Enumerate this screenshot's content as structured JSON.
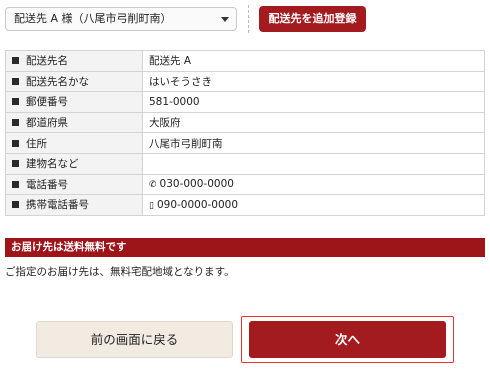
{
  "address_selector": {
    "selected": "配送先 A 様（八尾市弓削町南）"
  },
  "add_address_button": "配送先を追加登録",
  "address_table": [
    {
      "label": "配送先名",
      "value": "配送先 A"
    },
    {
      "label": "配送先名かな",
      "value": "はいそうさき"
    },
    {
      "label": "郵便番号",
      "value": "581-0000"
    },
    {
      "label": "都道府県",
      "value": "大阪府"
    },
    {
      "label": "住所",
      "value": "八尾市弓削町南"
    },
    {
      "label": "建物名など",
      "value": ""
    },
    {
      "label": "電話番号",
      "value": "030-000-0000",
      "icon": "phone-icon"
    },
    {
      "label": "携帯電話番号",
      "value": "090-0000-0000",
      "icon": "mobile-phone-icon"
    }
  ],
  "shipping_banner": "お届け先は送料無料です",
  "shipping_note": "ご指定のお届け先は、無料宅配地域となります。",
  "back_button": "前の画面に戻る",
  "next_button": "次へ",
  "colors": {
    "accent": "#a31a1f",
    "highlight_border": "#e8342c",
    "back_button_bg": "#f1ebe2"
  }
}
